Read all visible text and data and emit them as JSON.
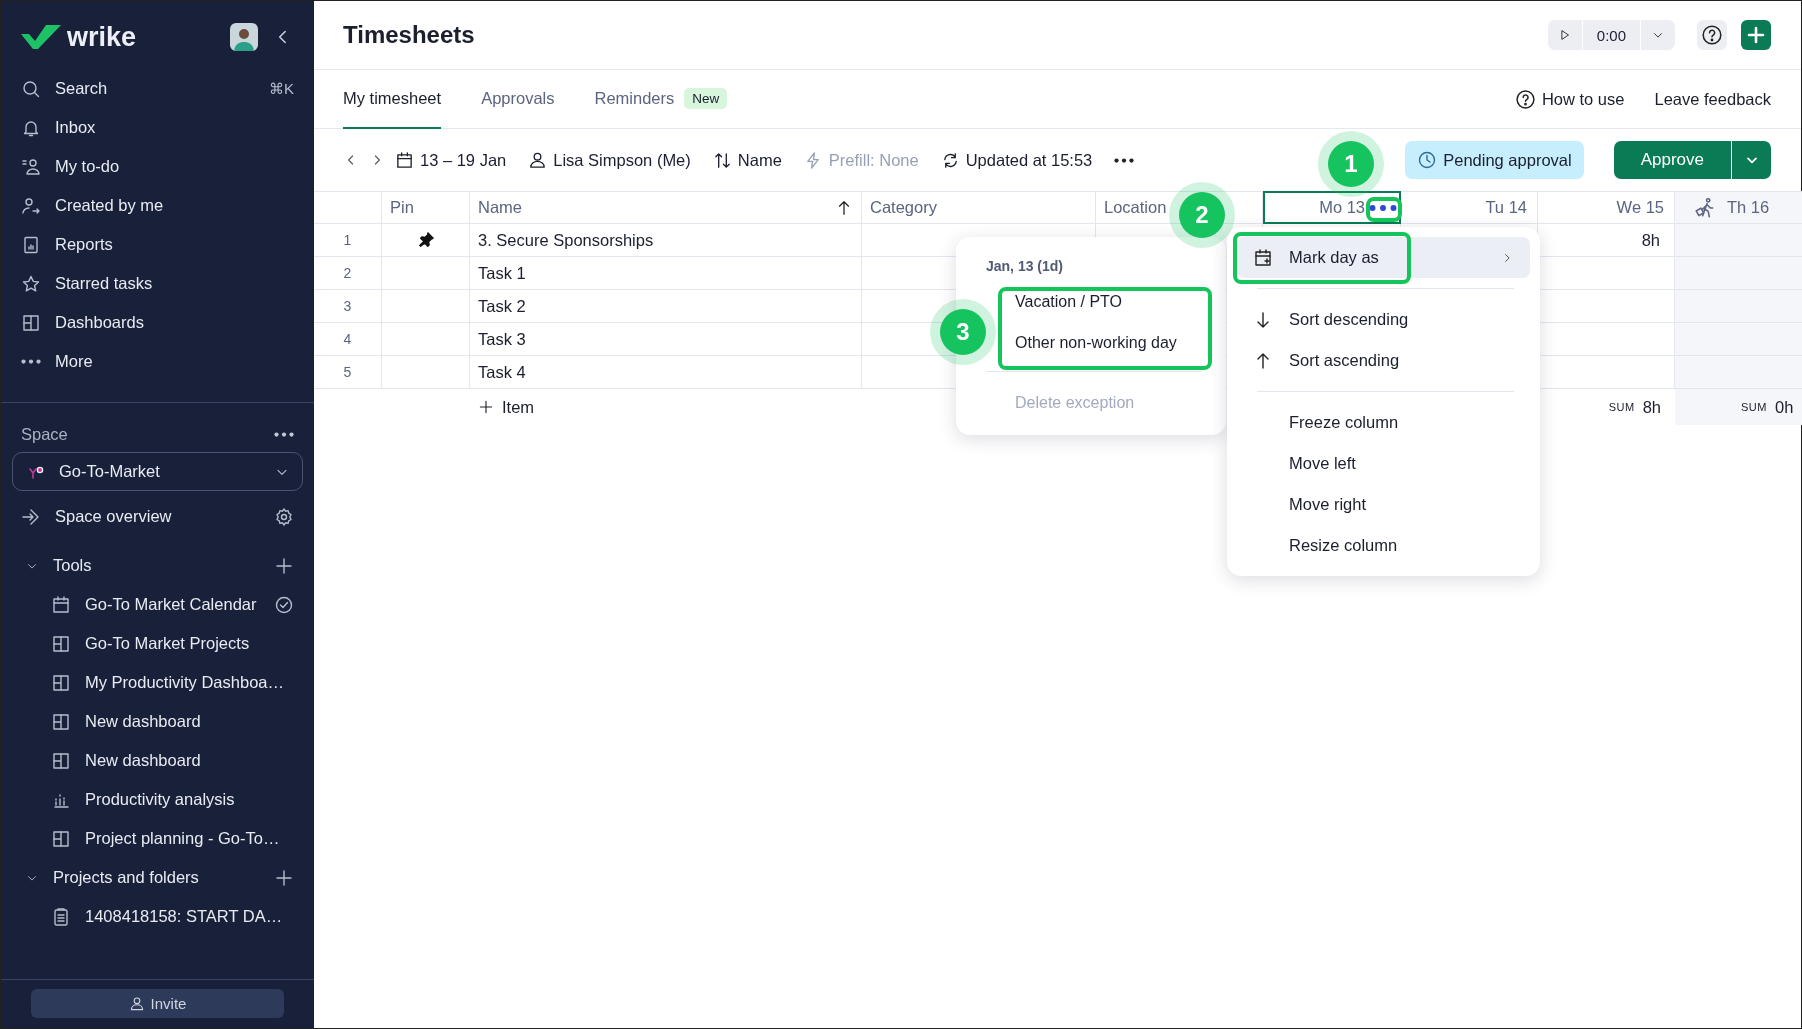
{
  "sidebar": {
    "logo": "wrike",
    "nav": [
      {
        "label": "Search",
        "shortcut": "⌘K"
      },
      {
        "label": "Inbox"
      },
      {
        "label": "My to-do"
      },
      {
        "label": "Created by me"
      },
      {
        "label": "Reports"
      },
      {
        "label": "Starred tasks"
      },
      {
        "label": "Dashboards"
      },
      {
        "label": "More"
      }
    ],
    "space_label": "Space",
    "space": "Go-To-Market",
    "space_overview": "Space overview",
    "sections": [
      {
        "title": "Tools",
        "expanded": true,
        "items": [
          {
            "label": "Go-To Market Calendar",
            "kind": "calendar",
            "checked": true
          },
          {
            "label": "Go-To Market Projects",
            "kind": "dashboard",
            "checked": false
          },
          {
            "label": "My Productivity Dashboa…",
            "kind": "dashboard",
            "checked": false
          },
          {
            "label": "New dashboard",
            "kind": "dashboard",
            "checked": false
          },
          {
            "label": "New dashboard",
            "kind": "dashboard",
            "checked": false
          },
          {
            "label": "Productivity analysis",
            "kind": "analytics",
            "checked": false
          },
          {
            "label": "Project planning - Go-To…",
            "kind": "dashboard",
            "checked": false
          }
        ]
      },
      {
        "title": "Projects and folders",
        "expanded": true,
        "items": [
          {
            "label": "1408418158: START DA…",
            "kind": "project",
            "checked": false
          }
        ]
      }
    ],
    "invite": "Invite"
  },
  "main": {
    "title": "Timesheets",
    "timer": "0:00",
    "tabs": [
      {
        "label": "My timesheet",
        "selected": true
      },
      {
        "label": "Approvals",
        "selected": false
      },
      {
        "label": "Reminders",
        "selected": false,
        "badge": "New"
      }
    ],
    "links": [
      "How to use",
      "Leave feedback"
    ],
    "toolbar": {
      "period": "13 – 19 Jan",
      "person": "Lisa Simpson (Me)",
      "sort": "Name",
      "prefill": {
        "label": "Prefill: None",
        "disabled": true
      },
      "updated": "Updated at 15:53"
    },
    "status": "Pending approval",
    "approve": "Approve"
  },
  "table": {
    "columns": [
      {
        "label": "Pin",
        "kind": "text",
        "sorted": false
      },
      {
        "label": "Name",
        "kind": "text",
        "sorted": true
      },
      {
        "label": "Category",
        "kind": "text",
        "sorted": false
      },
      {
        "label": "Location",
        "kind": "text",
        "sorted": false
      },
      {
        "label": "Mo 13",
        "kind": "day",
        "focused": true,
        "away": false
      },
      {
        "label": "Tu 14",
        "kind": "day",
        "focused": false,
        "away": false
      },
      {
        "label": "We 15",
        "kind": "day",
        "focused": false,
        "away": false
      },
      {
        "label": "Th 16",
        "kind": "day",
        "focused": false,
        "away": true
      }
    ],
    "rows": [
      {
        "number": "1",
        "pinned": true,
        "name": "3. Secure Sponsorships",
        "hours": {
          "day_3": "8h"
        }
      },
      {
        "number": "2",
        "pinned": false,
        "name": "Task 1"
      },
      {
        "number": "3",
        "pinned": false,
        "name": "Task 2"
      },
      {
        "number": "4",
        "pinned": false,
        "name": "Task 3"
      },
      {
        "number": "5",
        "pinned": false,
        "name": "Task 4"
      }
    ],
    "add_item": "Item",
    "sums": {
      "day_3": {
        "label": "SUM",
        "value": "8h"
      },
      "day_4": {
        "label": "SUM",
        "value": "0h"
      }
    }
  },
  "column_menu": {
    "items": [
      {
        "kind": "submenu",
        "label": "Mark day as",
        "highlighted": true
      },
      {
        "kind": "divider"
      },
      {
        "kind": "sortdown",
        "label": "Sort descending",
        "highlighted": false
      },
      {
        "kind": "sortup",
        "label": "Sort ascending",
        "highlighted": false
      },
      {
        "kind": "divider"
      },
      {
        "kind": "plain",
        "label": "Freeze column",
        "highlighted": false
      },
      {
        "kind": "plain",
        "label": "Move left",
        "highlighted": false
      },
      {
        "kind": "plain",
        "label": "Move right",
        "highlighted": false
      },
      {
        "kind": "plain",
        "label": "Resize column",
        "highlighted": false
      }
    ]
  },
  "day_menu": {
    "title": "Jan, 13 (1d)",
    "options": [
      {
        "label": "Vacation / PTO"
      },
      {
        "label": "Other non-working day"
      }
    ],
    "delete": {
      "label": "Delete exception",
      "disabled": true
    }
  },
  "callouts": [
    {
      "number": "1"
    },
    {
      "number": "2"
    },
    {
      "number": "3"
    }
  ]
}
